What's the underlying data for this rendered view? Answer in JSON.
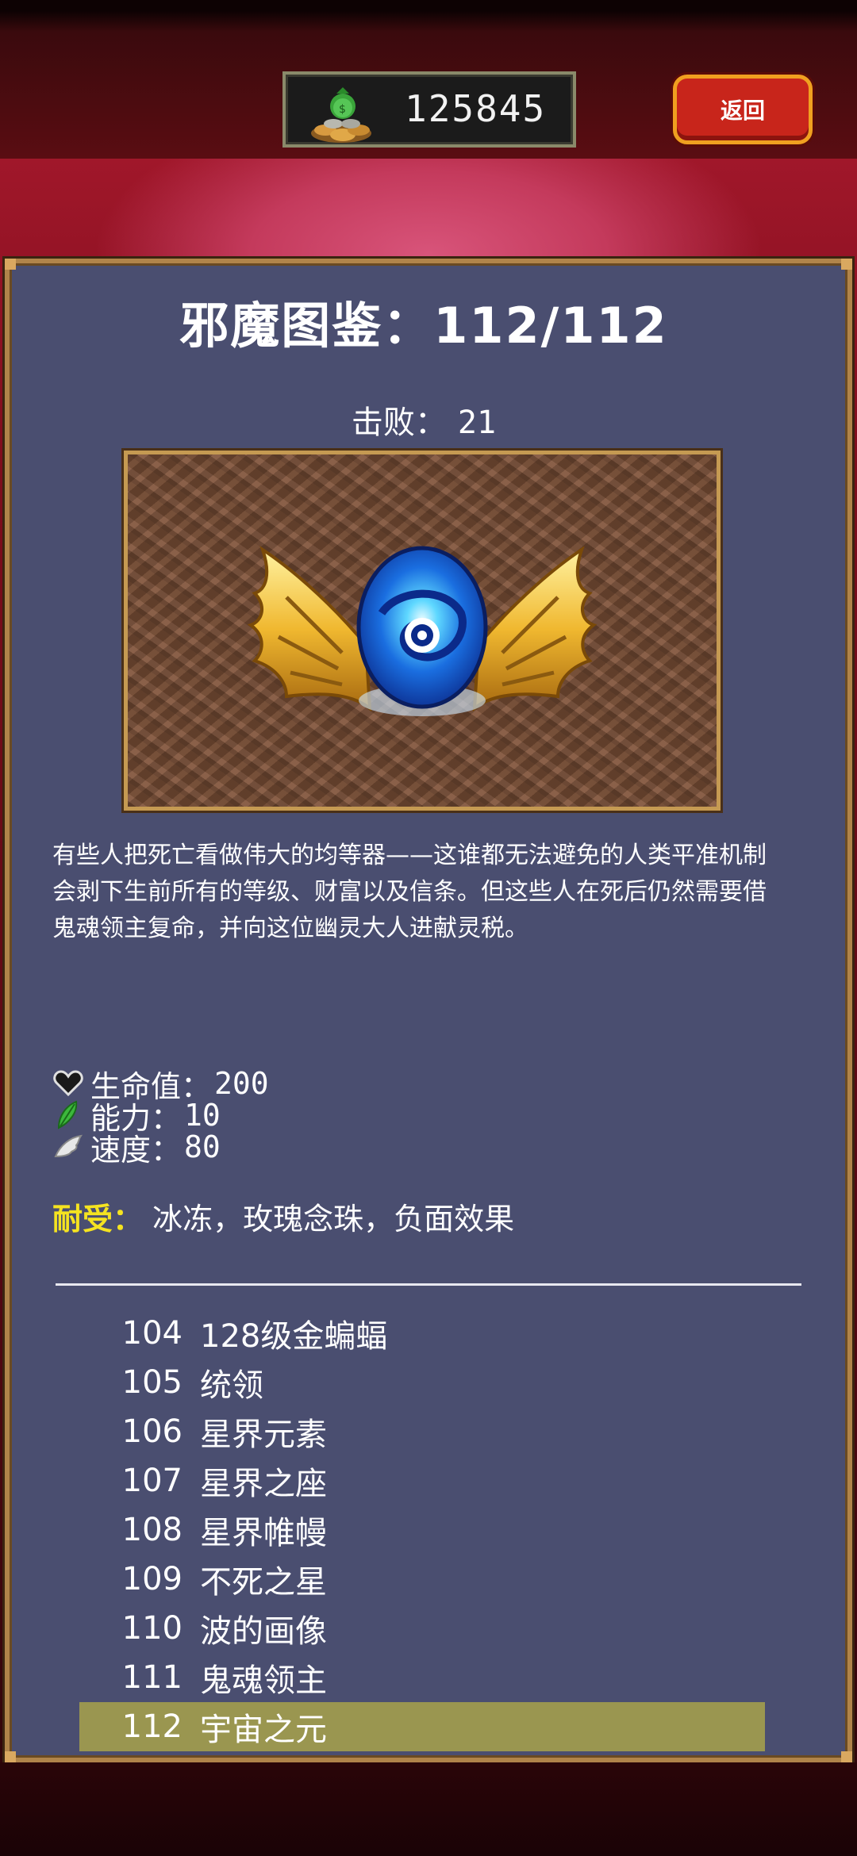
{
  "header": {
    "currency_icon": "money-bag-coins-icon",
    "currency_value": "125845",
    "back_label": "返回"
  },
  "codex": {
    "title": "邪魔图鉴：112/112",
    "defeated_label": "击败：",
    "defeated_count": "21",
    "monster_image": "winged-blue-orb-monster",
    "description_lines": [
      "有些人把死亡看做伟大的均等器——这谁都无法避免的人类平准机制",
      "会剥下生前所有的等级、财富以及信条。但这些人在死后仍然需要借",
      "鬼魂领主复命，并向这位幽灵大人进献灵税。"
    ],
    "stats": [
      {
        "icon": "heart-icon",
        "label": "生命值：",
        "value": "200"
      },
      {
        "icon": "feather-icon",
        "label": "能力：",
        "value": "10"
      },
      {
        "icon": "wing-icon",
        "label": "速度：",
        "value": "80"
      }
    ],
    "resist_label": "耐受：",
    "resist_value": "冰冻，玫瑰念珠，负面效果"
  },
  "monster_list": [
    {
      "index": "104",
      "name": "128级金蝙蝠",
      "selected": false
    },
    {
      "index": "105",
      "name": "统领",
      "selected": false
    },
    {
      "index": "106",
      "name": "星界元素",
      "selected": false
    },
    {
      "index": "107",
      "name": "星界之座",
      "selected": false
    },
    {
      "index": "108",
      "name": "星界帷幔",
      "selected": false
    },
    {
      "index": "109",
      "name": "不死之星",
      "selected": false
    },
    {
      "index": "110",
      "name": "波的画像",
      "selected": false
    },
    {
      "index": "111",
      "name": "鬼魂领主",
      "selected": false
    },
    {
      "index": "112",
      "name": "宇宙之元",
      "selected": true
    }
  ],
  "colors": {
    "panel_bg": "#4a4e70",
    "panel_border": "#b0844a",
    "selected_row": "#9a9650",
    "resist_label": "#f5e320",
    "back_button": "#c8251b"
  }
}
